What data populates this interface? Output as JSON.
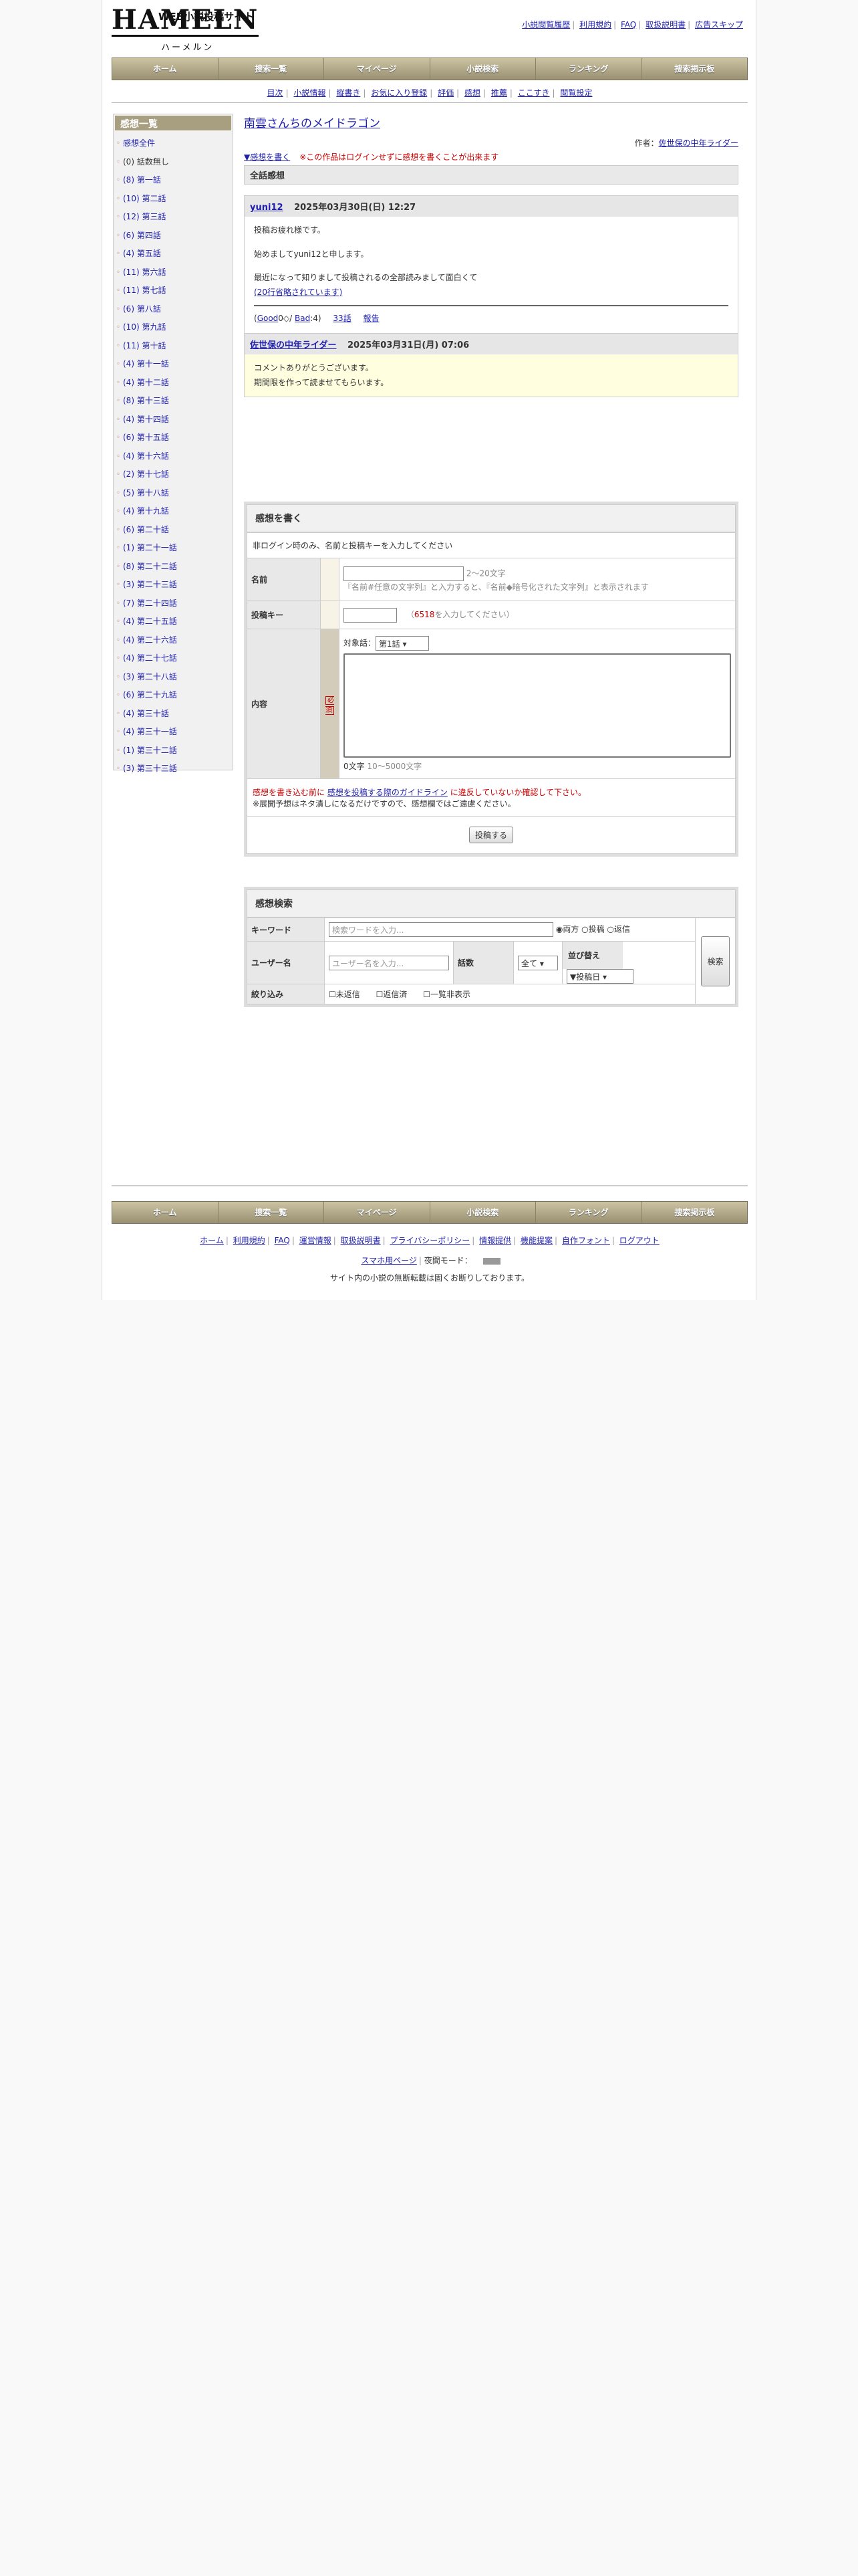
{
  "logo": {
    "top": "WEB小説投稿サイト",
    "main": "HAMELN",
    "sub": "ハーメルン"
  },
  "toplinks": [
    "小説閲覧履歴",
    "利用規約",
    "FAQ",
    "取扱説明書",
    "広告スキップ"
  ],
  "gnav": [
    "ホーム",
    "捜索一覧",
    "マイページ",
    "小説検索",
    "ランキング",
    "捜索掲示板"
  ],
  "subnav": [
    "目次",
    "小説情報",
    "縦書き",
    "お気に入り登録",
    "評価",
    "感想",
    "推薦",
    "ここすき",
    "閲覧設定"
  ],
  "sidebar": {
    "title": "感想一覧",
    "items": [
      "感想全件",
      "(0) 話数無し",
      "(8) 第一話",
      "(10) 第二話",
      "(12) 第三話",
      "(6) 第四話",
      "(4) 第五話",
      "(11) 第六話",
      "(11) 第七話",
      "(6) 第八話",
      "(10) 第九話",
      "(11) 第十話",
      "(4) 第十一話",
      "(4) 第十二話",
      "(8) 第十三話",
      "(4) 第十四話",
      "(6) 第十五話",
      "(4) 第十六話",
      "(2) 第十七話",
      "(5) 第十八話",
      "(4) 第十九話",
      "(6) 第二十話",
      "(1) 第二十一話",
      "(8) 第二十二話",
      "(3) 第二十三話",
      "(7) 第二十四話",
      "(4) 第二十五話",
      "(4) 第二十六話",
      "(4) 第二十七話",
      "(3) 第二十八話",
      "(6) 第二十九話",
      "(4) 第三十話",
      "(4) 第三十一話",
      "(1) 第三十二話",
      "(3) 第三十三話"
    ]
  },
  "novel": {
    "title": "南雲さんちのメイドラゴン",
    "author_label": "作者：",
    "author": "佐世保の中年ライダー"
  },
  "notice": {
    "write": "▼感想を書く",
    "warning": "※この作品はログインせずに感想を書くことが出来ます"
  },
  "section_all": "全話感想",
  "review": {
    "user": "yuni12",
    "date": "2025年03月30日(日) 12:27",
    "line1": "投稿お疲れ様です。",
    "line2": "始めましてyuni12と申します。",
    "line3": "最近になって知りまして投稿されるの全部読みまして面白くて",
    "more": "(20行省略されています)",
    "good_label": "Good",
    "good_count": "0",
    "bad_label": "Bad",
    "bad_count": "4",
    "episode": "33話",
    "report": "報告"
  },
  "reply": {
    "user": "佐世保の中年ライダー",
    "date": "2025年03月31日(月) 07:06",
    "line1": "コメントありがとうございます。",
    "line2": "期間限を作って読ませてもらいます。"
  },
  "form": {
    "title": "感想を書く",
    "note": "非ログイン時のみ、名前と投稿キーを入力してください",
    "name_label": "名前",
    "name_hint": "2〜20文字",
    "name_hint2": "『名前#任意の文字列』と入力すると、『名前◆暗号化された文字列』と表示されます",
    "key_label": "投稿キー",
    "key_value": "6518",
    "key_hint": "を入力してください",
    "content_label": "内容",
    "required": "必須",
    "target_label": "対象話：",
    "target_value": "第1話",
    "count": "0文字",
    "count_range": "10〜5000文字",
    "guide_pre": "感想を書き込む前に",
    "guide_link": "感想を投稿する際のガイドライン",
    "guide_post": "に違反していないか確認して下さい。",
    "spoiler": "※展開予想はネタ潰しになるだけですので、感想欄ではご遠慮ください。",
    "submit": "投稿する"
  },
  "search": {
    "title": "感想検索",
    "keyword_label": "キーワード",
    "keyword_ph": "検索ワードを入力...",
    "opt1": "両方",
    "opt2": "投稿",
    "opt3": "返信",
    "user_label": "ユーザー名",
    "user_ph": "ユーザー名を入力...",
    "ep_label": "話数",
    "ep_value": "全て",
    "sort_label": "並び替え",
    "sort_value": "▼投稿日",
    "filter_label": "絞り込み",
    "f1": "未返信",
    "f2": "返信済",
    "f3": "一覧非表示",
    "button": "検索"
  },
  "footer": {
    "links": [
      "ホーム",
      "利用規約",
      "FAQ",
      "運営情報",
      "取扱説明書",
      "プライバシーポリシー",
      "情報提供",
      "機能提案",
      "自作フォント",
      "ログアウト"
    ],
    "sp": "スマホ用ページ",
    "night": "夜間モード：",
    "copy": "サイト内の小説の無断転載は固くお断りしております。"
  }
}
